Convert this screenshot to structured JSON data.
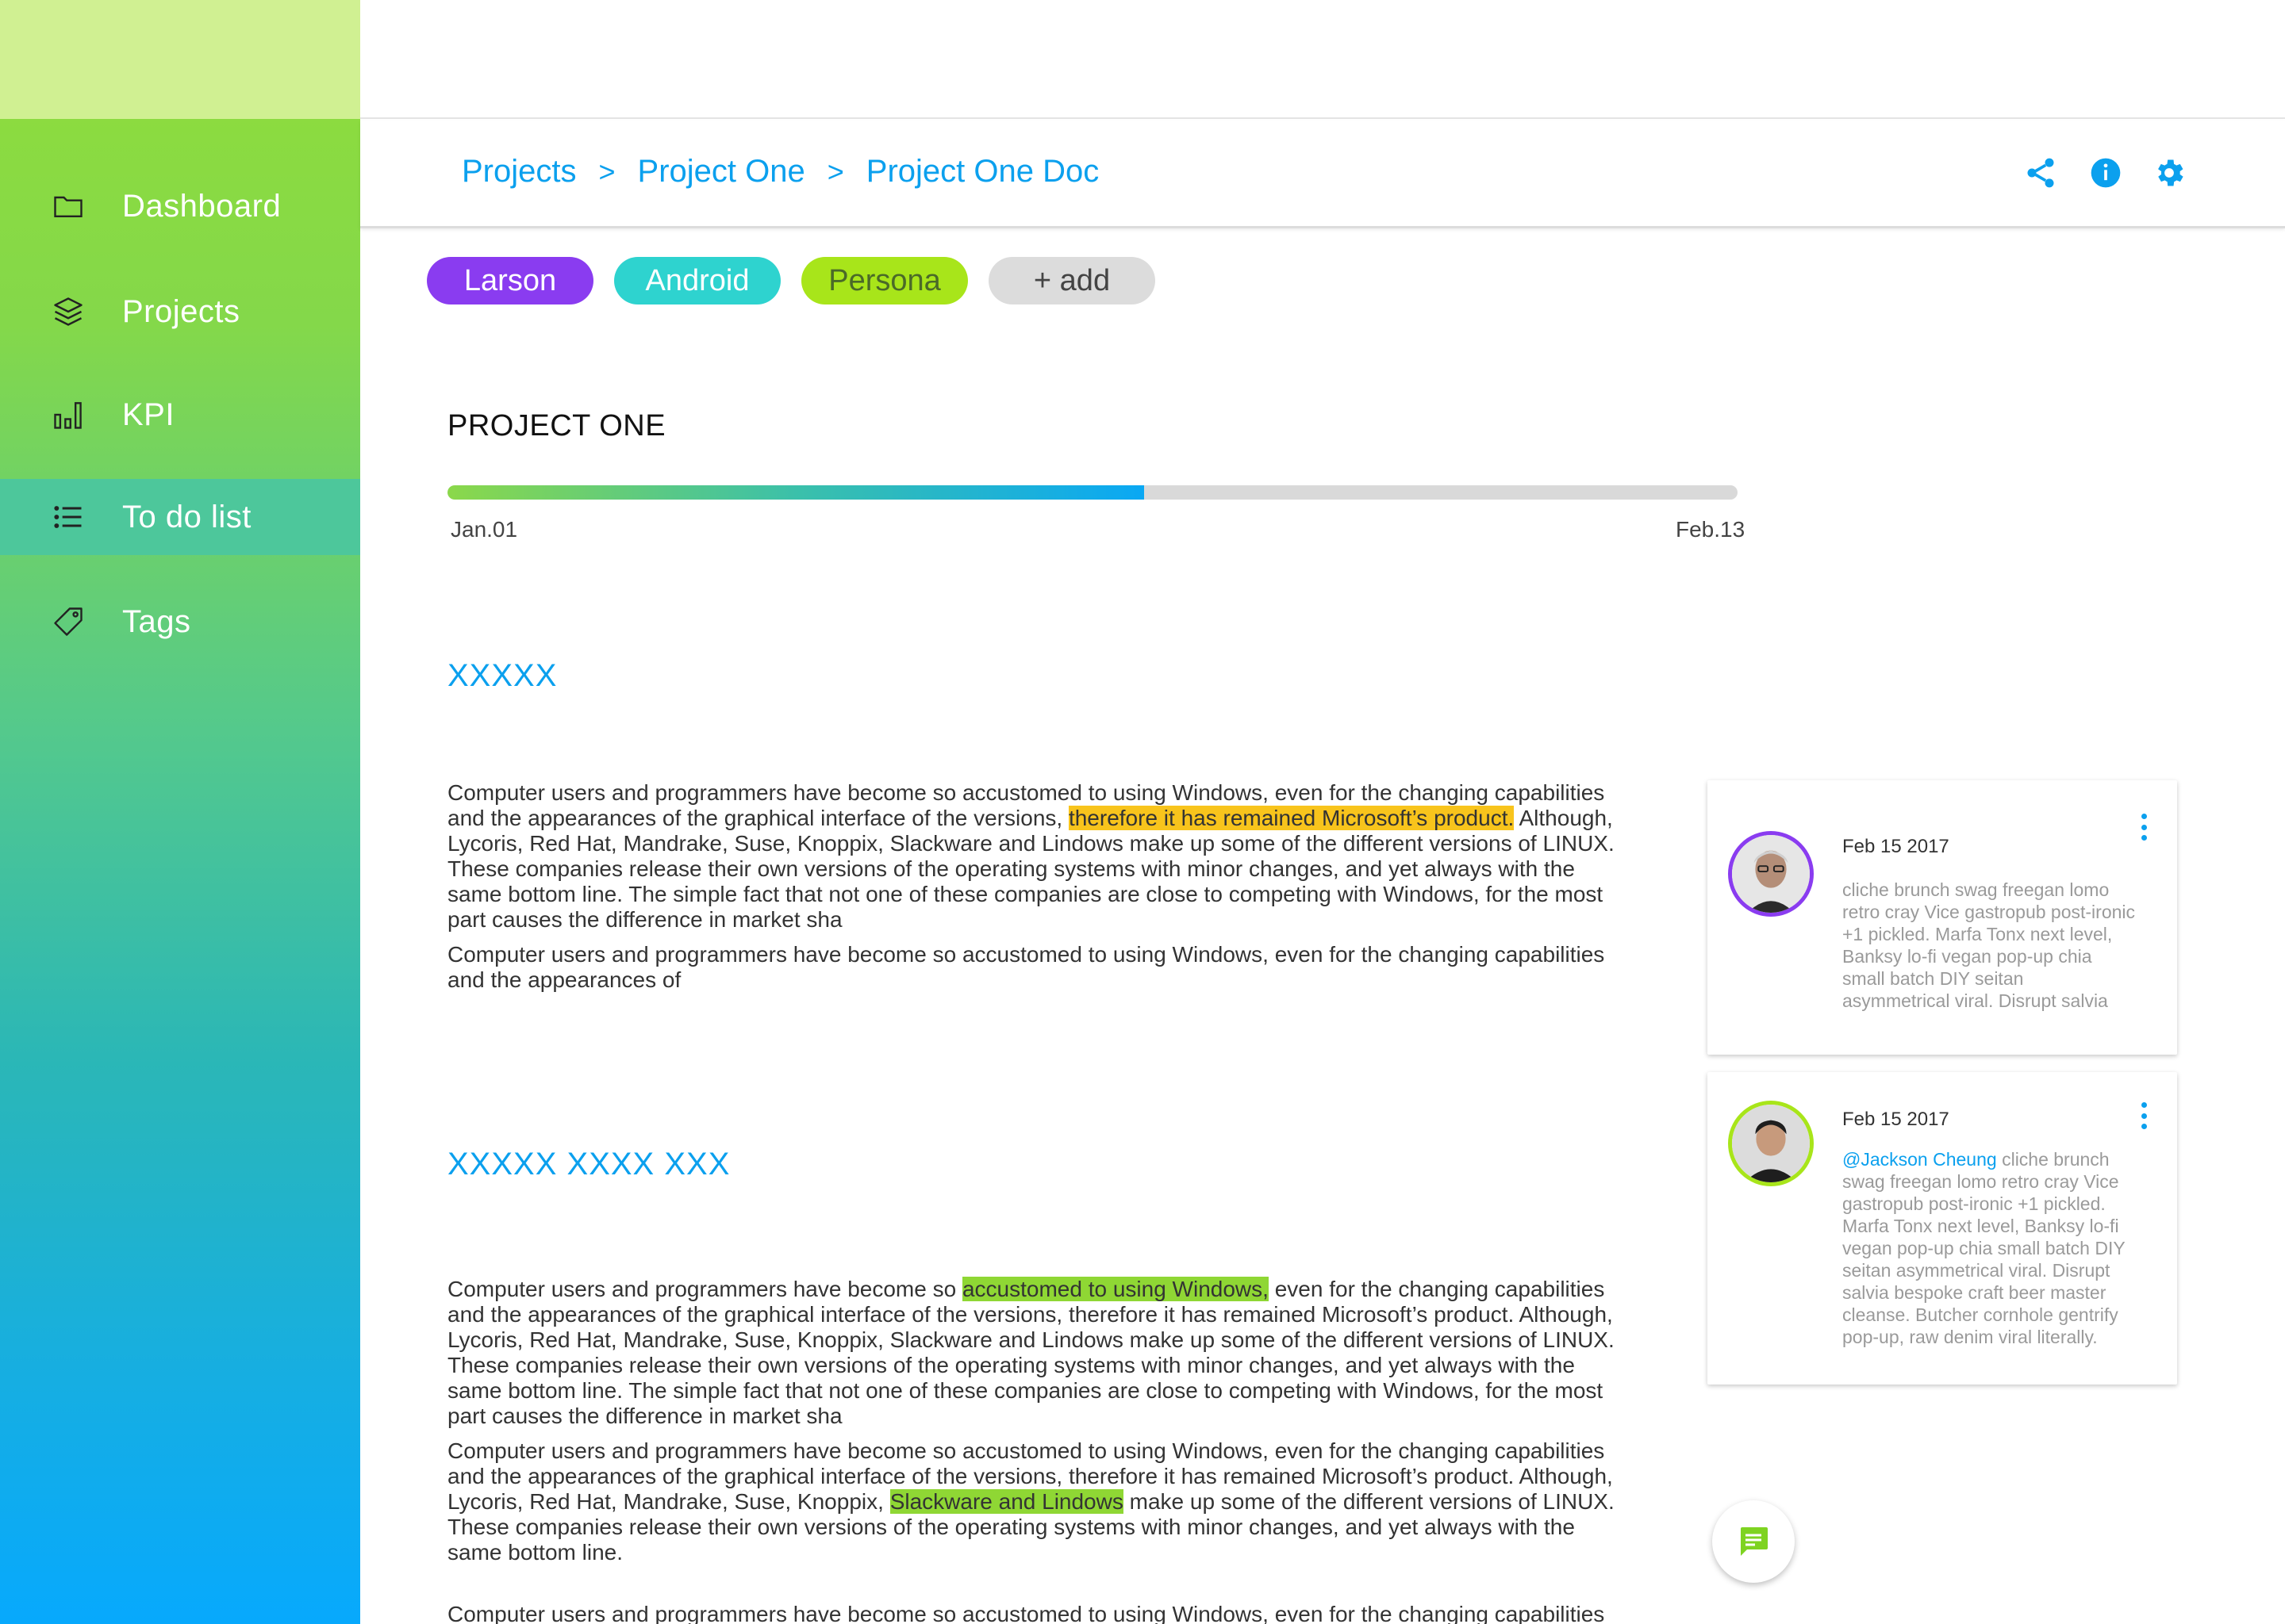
{
  "sidebar": {
    "items": [
      {
        "label": "Dashboard",
        "icon": "folder-icon"
      },
      {
        "label": "Projects",
        "icon": "layers-icon"
      },
      {
        "label": "KPI",
        "icon": "bar-chart-icon"
      },
      {
        "label": "To do list",
        "icon": "list-icon",
        "active": true
      },
      {
        "label": "Tags",
        "icon": "tag-icon"
      }
    ]
  },
  "header": {
    "breadcrumb": [
      "Projects",
      "Project One",
      "Project One Doc"
    ],
    "separator": ">",
    "icons": [
      "share-icon",
      "info-icon",
      "settings-icon"
    ]
  },
  "tags": [
    {
      "label": "Larson",
      "color": "#8a3cf0"
    },
    {
      "label": "Android",
      "color": "#2ed3cf"
    },
    {
      "label": "Persona",
      "color": "#a8e51a"
    },
    {
      "label": "+ add",
      "color": "#dcdcdc"
    }
  ],
  "project": {
    "title": "PROJECT ONE",
    "progress": 0.54,
    "start_date": "Jan.01",
    "end_date": "Feb.13"
  },
  "sections": [
    {
      "heading": "XXXXX",
      "paragraphs": [
        {
          "before": "Computer users and programmers have become so accustomed to using Windows, even for the changing capabilities and the appearances of the graphical interface of the versions, ",
          "highlight": "therefore it has remained Microsoft’s product.",
          "after": " Although, Lycoris, Red Hat, Mandrake, Suse, Knoppix, Slackware and Lindows make up some of the different versions of LINUX. These companies release their own versions of the operating systems with minor changes, and yet always with the same bottom line. The simple fact that not one of these companies are close to competing with Windows, for the most part causes the difference in market sha"
        },
        {
          "text": "Computer users and programmers have become so accustomed to using Windows, even for the changing capabilities and the appearances of"
        }
      ]
    },
    {
      "heading": "XXXXX XXXX XXX",
      "paragraphs": [
        {
          "before": "Computer users and programmers have become so ",
          "highlight": "accustomed to using Windows,",
          "after": " even for the changing capabilities and the appearances of the graphical interface of the versions, therefore it has remained Microsoft’s product. Although, Lycoris, Red Hat, Mandrake, Suse, Knoppix, Slackware and Lindows make up some of the different versions of LINUX. These companies release their own versions of the operating systems with minor changes, and yet always with the same bottom line. The simple fact that not one of these companies are close to competing with Windows, for the most part causes the difference in market sha"
        },
        {
          "before": "Computer users and programmers have become so accustomed to using Windows, even for the changing capabilities and the appearances of the graphical interface of the versions, therefore it has remained Microsoft’s product. Although, Lycoris, Red Hat, Mandrake, Suse, Knoppix, ",
          "highlight": "Slackware and Lindows",
          "after": " make up some of the different versions of LINUX. These companies release their own versions of the operating systems with minor changes, and yet always with the same bottom line."
        },
        {
          "text": "Computer users and programmers have become so accustomed to using Windows, even for the changing capabilities"
        }
      ]
    }
  ],
  "comments": [
    {
      "date": "Feb 15 2017",
      "text": "cliche brunch swag freegan lomo retro cray Vice gastropub post-ironic +1 pickled. Marfa Tonx next level, Banksy lo-fi vegan pop-up chia small batch DIY seitan asymmetrical viral. Disrupt salvia",
      "avatar_ring": "#8a3cf0"
    },
    {
      "date": "Feb 15 2017",
      "mention": "@Jackson Cheung",
      "text": " cliche brunch swag freegan lomo retro cray Vice gastropub post-ironic +1 pickled. Marfa Tonx next level, Banksy lo-fi vegan pop-up chia small batch DIY seitan asymmetrical viral. Disrupt salvia bespoke craft beer master cleanse. Butcher cornhole gentrify pop-up, raw denim viral literally.",
      "avatar_ring": "#a8e51a"
    }
  ],
  "fab": {
    "icon": "comment-icon"
  }
}
